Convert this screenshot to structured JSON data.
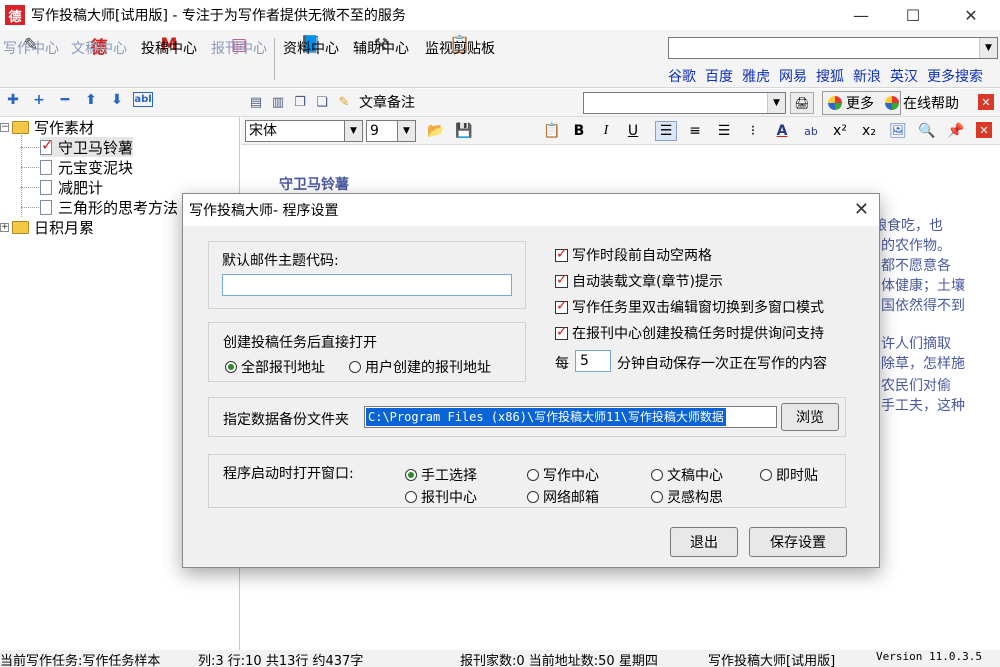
{
  "window": {
    "title": "写作投稿大师[试用版] - 专注于为写作者提供无微不至的服务",
    "logo_char": "德",
    "minimize": "—",
    "maximize": "☐",
    "close": "✕"
  },
  "main_toolbar": {
    "items": [
      {
        "label": "写作中心",
        "icon": "pencil-note-icon",
        "enabled": false
      },
      {
        "label": "文稿中心",
        "icon": "stamp-icon",
        "enabled": false
      },
      {
        "label": "投稿中心",
        "icon": "mail-icon",
        "enabled": true
      },
      {
        "label": "报刊中心",
        "icon": "newspaper-icon",
        "enabled": false
      },
      {
        "label": "资料中心",
        "icon": "book-icon",
        "enabled": true
      },
      {
        "label": "辅助中心",
        "icon": "hammer-icon",
        "enabled": true
      },
      {
        "label": "监视剪贴板",
        "icon": "clipboard-icon",
        "enabled": true
      }
    ]
  },
  "search": {
    "value": "",
    "engines": [
      "谷歌",
      "百度",
      "雅虎",
      "网易",
      "搜狐",
      "新浪",
      "英汉",
      "更多搜索"
    ]
  },
  "tree_toolbar": [
    "✚",
    "+",
    "━",
    "⬆",
    "⬇",
    "abl"
  ],
  "doc_toolbar": {
    "note_label": "文章备注",
    "note_value": "",
    "more_label": "更多",
    "help_label": "在线帮助"
  },
  "tree": {
    "root1": "写作素材",
    "items": [
      "守卫马铃薯",
      "元宝变泥块",
      "减肥计",
      "三角形的思考方法"
    ],
    "root2": "日积月累"
  },
  "format_bar": {
    "font": "宋体",
    "size": "9",
    "bold": "B",
    "italic": "I",
    "underline": "U"
  },
  "editor": {
    "heading": "守卫马铃薯",
    "visible_fragments": [
      "粮食吃，也",
      "的农作物。",
      "都不愿意各",
      "体健康；土壤",
      "国依然得不到",
      "许人们摘取",
      "除草，怎样施",
      "农民们对偷",
      "手工夫，这种"
    ]
  },
  "dialog": {
    "title": "写作投稿大师- 程序设置",
    "close": "✕",
    "mail_subject_label": "默认邮件主题代码:",
    "mail_subject_value": "",
    "open_after_create_label": "创建投稿任务后直接打开",
    "open_options": [
      "全部报刊地址",
      "用户创建的报刊地址"
    ],
    "open_selected": 0,
    "checkboxes": [
      {
        "label": "写作时段前自动空两格",
        "checked": true
      },
      {
        "label": "自动装载文章(章节)提示",
        "checked": true
      },
      {
        "label": "写作任务里双击编辑窗切换到多窗口模式",
        "checked": true
      },
      {
        "label": "在报刊中心创建投稿任务时提供询问支持",
        "checked": true
      }
    ],
    "autosave_prefix": "每",
    "autosave_minutes": "5",
    "autosave_suffix": "分钟自动保存一次正在写作的内容",
    "backup_label": "指定数据备份文件夹",
    "backup_path": "C:\\Program Files (x86)\\写作投稿大师11\\写作投稿大师数据",
    "browse_label": "浏览",
    "startup_label": "程序启动时打开窗口:",
    "startup_options": [
      "手工选择",
      "写作中心",
      "文稿中心",
      "即时贴",
      "报刊中心",
      "网络邮箱",
      "灵感构思"
    ],
    "startup_selected": 0,
    "exit_label": "退出",
    "save_label": "保存设置"
  },
  "status_bar": {
    "task": "当前写作任务:写作任务样本",
    "position": "列:3 行:10 共13行 约437字",
    "stats": "报刊家数:0 当前地址数:50 星期四",
    "product": "写作投稿大师[试用版]",
    "version": "Version 11.0.3.5"
  }
}
